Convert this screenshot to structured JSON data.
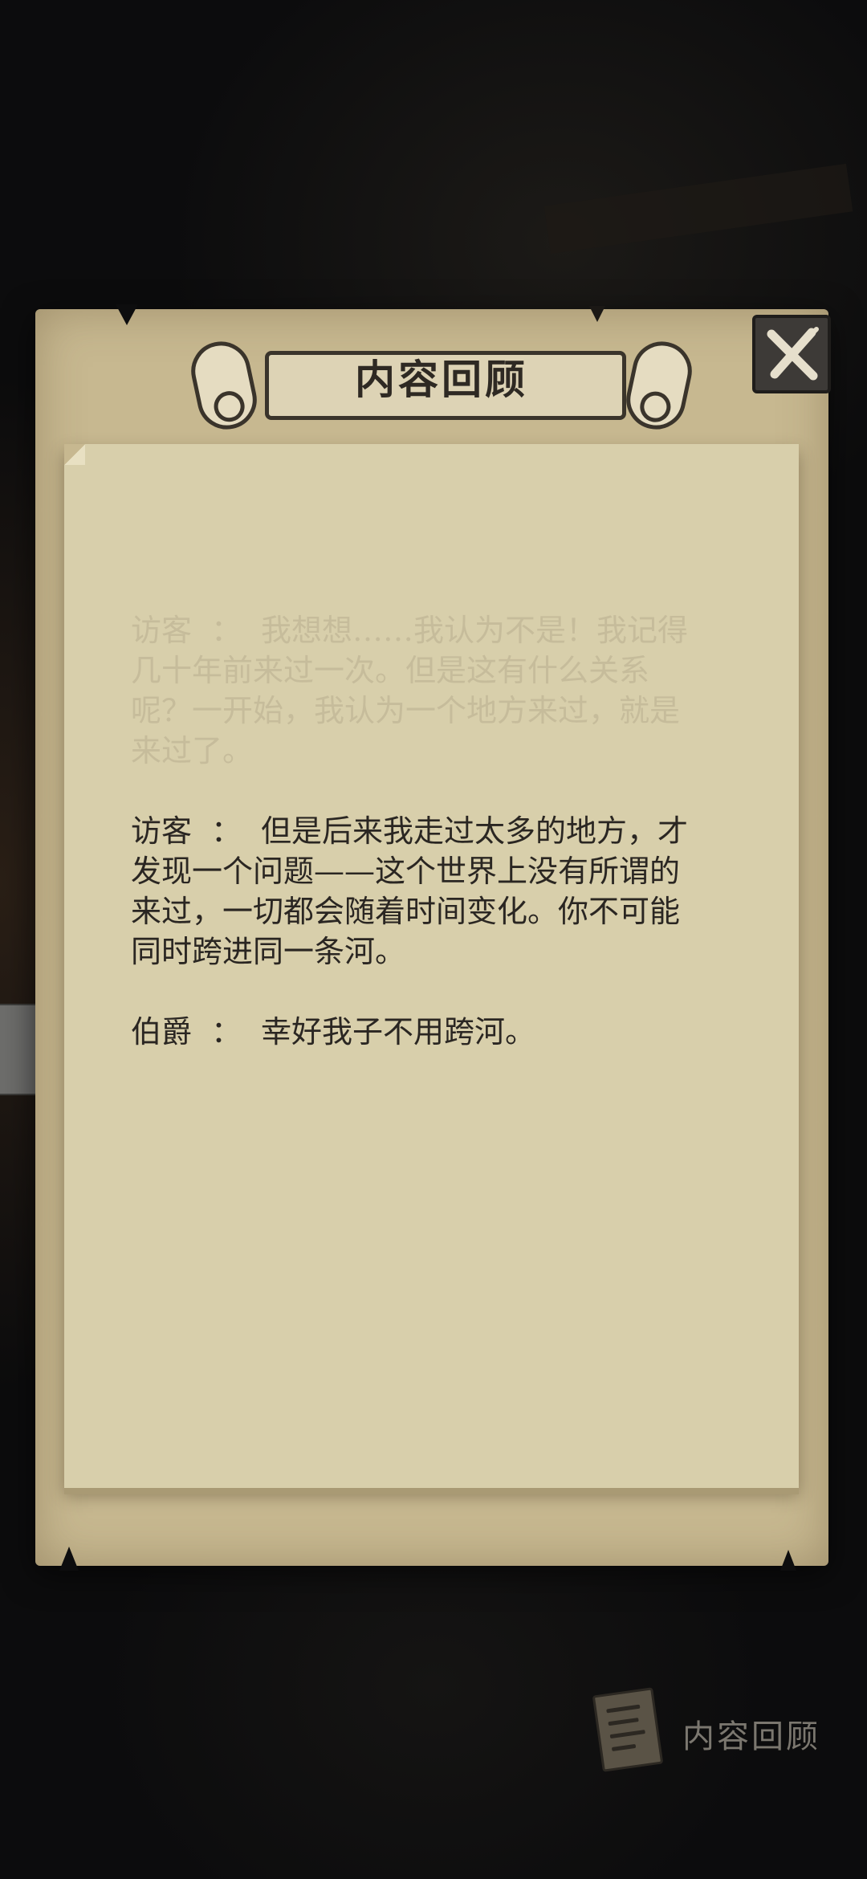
{
  "header": {
    "title": "内容回顾",
    "close_icon": "close-x-icon"
  },
  "dialog": [
    {
      "speaker": "访客",
      "separator": "：",
      "text_lines": [
        "我想想……我认为不是！我记得",
        "几十年前来过一次。但是这有什么关系",
        "呢？一开始，我认为一个地方来过，就是",
        "来过了。"
      ],
      "state": "partially-faded"
    },
    {
      "speaker": "访客",
      "separator": "：",
      "text_lines": [
        "但是后来我走过太多的地方，才",
        "发现一个问题——这个世界上没有所谓的",
        "来过，一切都会随着时间变化。你不可能",
        "同时跨进同一条河。"
      ],
      "state": "normal"
    },
    {
      "speaker": "伯爵",
      "separator": "：",
      "text_lines": [
        "幸好我子不用跨河。"
      ],
      "state": "normal"
    }
  ],
  "footer": {
    "review_label": "内容回顾",
    "review_icon": "scroll-paper-icon"
  },
  "colors": {
    "background": "#0d0d0e",
    "panel": "#c7b890",
    "paper": "#d8cfab",
    "text": "#2a2622"
  }
}
